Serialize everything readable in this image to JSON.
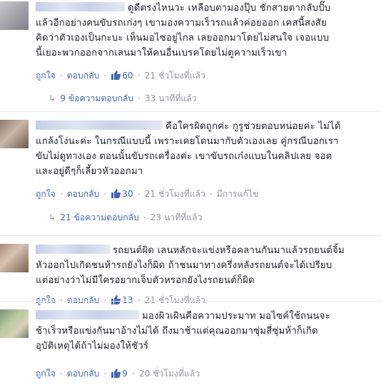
{
  "comments": [
    {
      "text_lines": [
        "ดูดีตรงไหนวะ เหลือบตามองปุ๊บ ชักสายตากลับปั๊บ",
        "แล้วอีกอย่างคนขับรถเก่งๆ เขามองความเร็วรถแล้วค่อยออก เคสนี้สงสัย",
        "คิดว่าตัวเองเป็นกะบะ เห็นมอไซอยู่ไกล เลยออกมาโดยไม่สนใจ เจอแบบ",
        "นี้เยอะพวกออกจากเลนมาให้คนอื่นเบรคโดยไม่ดูความเร็วเขา"
      ],
      "like_label": "ถูกใจ",
      "reply_label": "ตอบกลับ",
      "likes": "60",
      "time": "21 ชั่วโมงที่แล้ว",
      "replies": "9 ข้อความตอบกลับ",
      "replies_time": "33 นาทีที่แล้ว"
    },
    {
      "text_lines": [
        "คือใครผิดถูกค่ะ กูรูช่วยตอบหน่อยค่ะ ไม่ได้",
        "แกล้งโง่นะค่ะ ในกรณีแบบนี้ เพราะเคยโดนมากับตัวเองเลย คู่กรณีบอกเรา",
        "ขับไม่ดูทางเอง ตอนนั้นขับรถเครื่องค่ะ เขาขับรถเก๋งแบบในคลิปเลย จอด",
        "และอยู่ดีๆก็เลี้ยวหัวออกมา"
      ],
      "like_label": "ถูกใจ",
      "reply_label": "ตอบกลับ",
      "likes": "30",
      "time": "21 ชั่วโมงที่แล้ว",
      "edited": "มีการแก้ไข",
      "replies": "21 ข้อความตอบกลับ",
      "replies_time": "23 นาทีที่แล้ว"
    },
    {
      "text_lines": [
        "รถยนต์ผิด เลนหลักจะแข่งหรือคลานกันมาแล้วรถยนต์จิ้ม",
        "หัวออกไปเกิดชนห้ารถยังไงก็ผิด ถ้าชนมาทางครึ่งหลังรถยนต์จะได้เปรียบ",
        "แต่อย่างว่าไม่มีใครอยากเจ็บตัวหรอกยังไงรถยนต์ก็ผิด"
      ],
      "like_label": "ถูกใจ",
      "reply_label": "ตอบกลับ",
      "likes": "13",
      "time": "21 ชั่วโมงที่แล้ว"
    },
    {
      "text_lines": [
        "มองผิวเผินคือความประมาท มอไซค์ใช้ถนนจะ",
        "ช้าเร็วหรือแข่งกันมาอ้างไม่ได้ ถึงมาช้าแต่คุณออกมาซุ่มสี่ซุ่มห้าก็เกิด",
        "อุบัติเหตุได้ถ้าไม่มองให้ชัวร์"
      ],
      "like_label": "ถูกใจ",
      "reply_label": "ตอบกลับ",
      "likes": "9",
      "time": "20 ชั่วโมงที่แล้ว"
    }
  ],
  "colors": {
    "link": "#4267b2",
    "text": "#1d2129",
    "muted": "#90949c",
    "divider": "#e9ebee"
  },
  "icons": {
    "like": "thumbs-up-icon",
    "reply_arrow": "reply-arrow-icon"
  }
}
